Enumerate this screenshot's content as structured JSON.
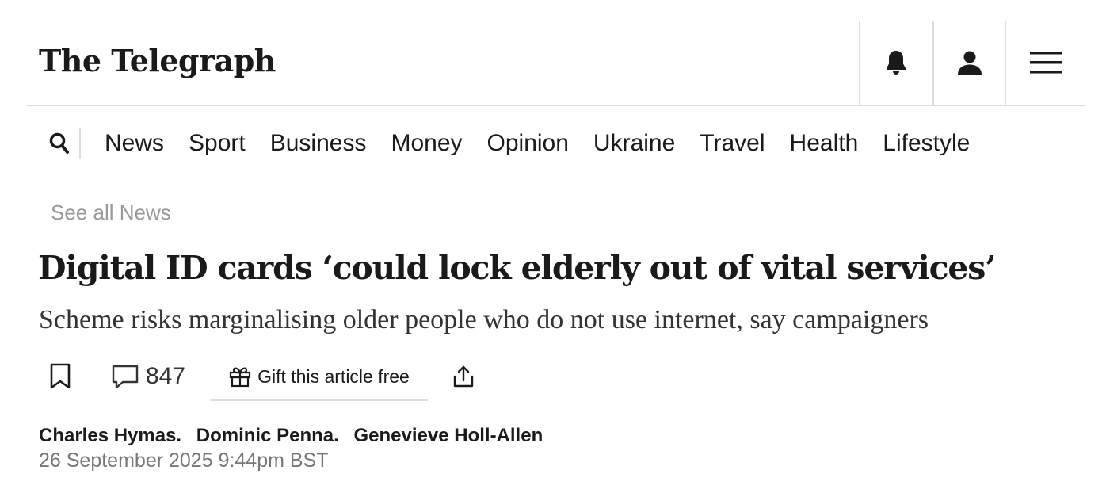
{
  "masthead": {
    "logo": "The Telegraph",
    "icons": [
      "bell-icon",
      "account-icon",
      "menu-icon"
    ]
  },
  "nav": {
    "search_icon": "search-icon",
    "items": [
      "News",
      "Sport",
      "Business",
      "Money",
      "Opinion",
      "Ukraine",
      "Travel",
      "Health",
      "Lifestyle"
    ]
  },
  "section_link": "See all News",
  "article": {
    "headline": "Digital ID cards ‘could lock elderly out of vital services’",
    "standfirst": "Scheme risks marginalising older people who do not use internet, say campaigners",
    "actions": {
      "bookmark_icon": "bookmark-icon",
      "comment_icon": "comment-icon",
      "comment_count": "847",
      "gift_icon": "gift-icon",
      "gift_label": "Gift this article free",
      "share_icon": "share-icon"
    },
    "authors": [
      "Charles Hymas.",
      "Dominic Penna.",
      "Genevieve Holl-Allen"
    ],
    "date": "26 September 2025 9:44pm BST"
  },
  "colors": {
    "text": "#1a1a1a",
    "muted": "#999999",
    "divider": "#dddddd"
  }
}
